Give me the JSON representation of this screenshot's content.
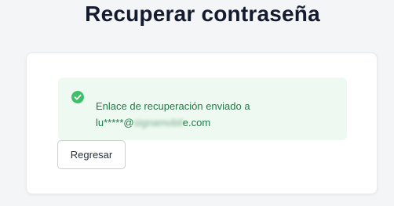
{
  "page": {
    "title": "Recuperar contraseña"
  },
  "alert": {
    "icon": "check-circle-icon",
    "line1": "Enlace de recuperación enviado a",
    "email_prefix": "lu*****@",
    "email_hidden": "signamobil",
    "email_suffix": "e.com",
    "colors": {
      "background": "#eefaf1",
      "text": "#1f7a45",
      "icon": "#3fbf6a"
    }
  },
  "actions": {
    "back_label": "Regresar"
  }
}
